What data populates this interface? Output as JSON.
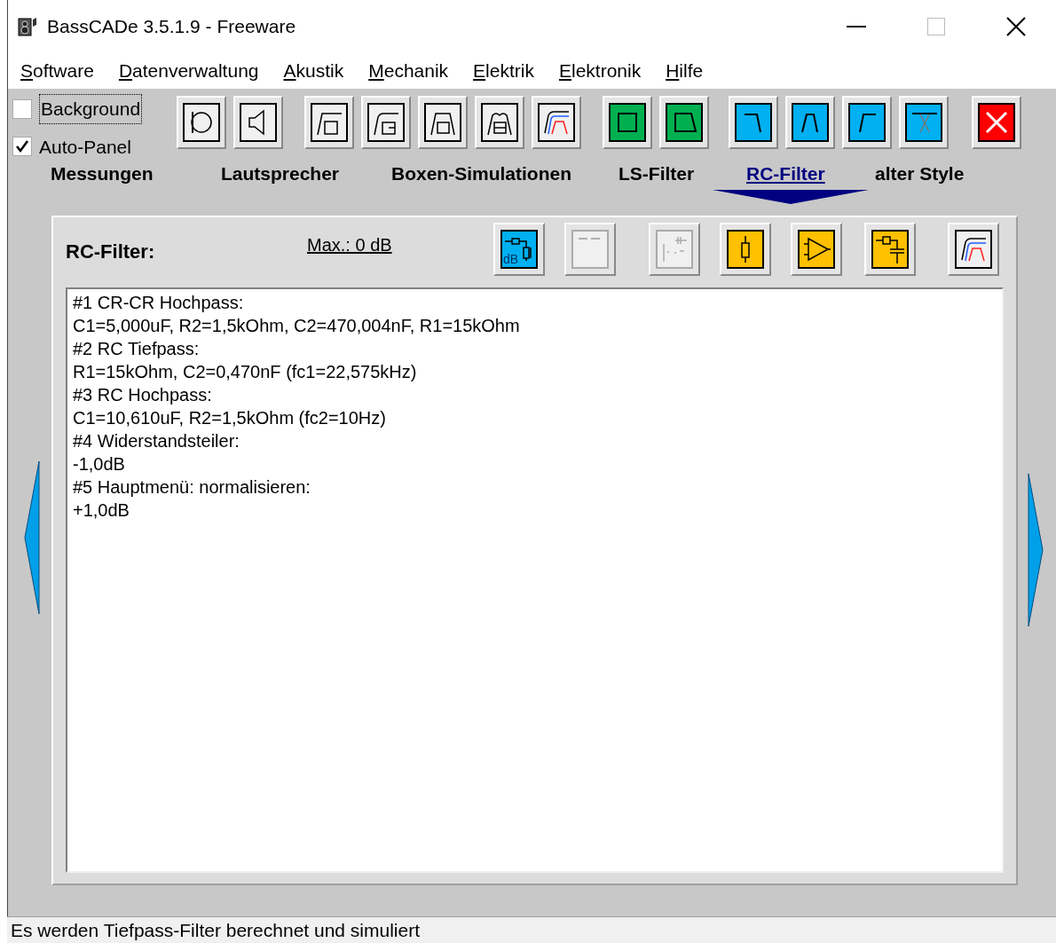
{
  "window": {
    "title": "BassCADe 3.5.1.9 - Freeware"
  },
  "menu": [
    {
      "key": "S",
      "rest": "oftware"
    },
    {
      "key": "D",
      "rest": "atenverwaltung"
    },
    {
      "key": "A",
      "rest": "kustik"
    },
    {
      "key": "M",
      "rest": "echanik"
    },
    {
      "key": "E",
      "rest": "lektrik"
    },
    {
      "key": "E",
      "rest": "lektronik"
    },
    {
      "key": "H",
      "rest": "ilfe"
    }
  ],
  "options": [
    {
      "label": "Background",
      "checked": false
    },
    {
      "label": "Auto-Panel",
      "checked": true
    }
  ],
  "toolbar": [
    {
      "label": "Messungen",
      "selected": false,
      "buttons": [
        {
          "kind": "round-speaker",
          "color": "#f0f0f0"
        },
        {
          "kind": "speaker",
          "color": "#f0f0f0"
        }
      ]
    },
    {
      "label": "Lautsprecher",
      "selected": false,
      "buttons": [
        {
          "kind": "closed-box",
          "color": "#f0f0f0"
        },
        {
          "kind": "vented-box",
          "color": "#f0f0f0"
        },
        {
          "kind": "bandpass-box",
          "color": "#f0f0f0"
        },
        {
          "kind": "double-box",
          "color": "#f0f0f0"
        },
        {
          "kind": "curves",
          "color": "#f0f0f0"
        }
      ]
    },
    {
      "label": "Boxen-Simulationen",
      "selected": false,
      "buttons": [
        {
          "kind": "square",
          "color": "#00b050"
        },
        {
          "kind": "trapezoid",
          "color": "#00b050"
        }
      ]
    },
    {
      "label": "LS-Filter",
      "selected": false,
      "buttons": [
        {
          "kind": "lowpass",
          "color": "#00b0f0"
        },
        {
          "kind": "bandpass",
          "color": "#00b0f0"
        },
        {
          "kind": "highpass",
          "color": "#00b0f0"
        },
        {
          "kind": "notch",
          "color": "#00b0f0"
        }
      ]
    },
    {
      "label": "RC-Filter",
      "selected": true,
      "buttons": [
        {
          "kind": "close",
          "color": "#ff0000"
        }
      ]
    },
    {
      "label": "alter Style",
      "selected": false
    }
  ],
  "panel": {
    "title": "RC-Filter:",
    "max_link": "Max.: 0 dB",
    "buttons": [
      {
        "kind": "attenuator",
        "color": "#00b0f0",
        "label": "dB",
        "disabled": false
      },
      {
        "kind": "blank",
        "color": "#f0f0f0",
        "disabled": true
      },
      {
        "kind": "circuit",
        "color": "#f0f0f0",
        "disabled": true
      },
      {
        "kind": "resistor",
        "color": "#ffc000",
        "disabled": false
      },
      {
        "kind": "amplifier",
        "color": "#ffc000",
        "disabled": false
      },
      {
        "kind": "rc",
        "color": "#ffc000",
        "disabled": false
      },
      {
        "kind": "curves",
        "color": "#f0f0f0",
        "disabled": false
      }
    ],
    "lines": [
      "#1 CR-CR Hochpass:",
      "C1=5,000uF, R2=1,5kOhm, C2=470,004nF, R1=15kOhm",
      "#2 RC Tiefpass:",
      "R1=15kOhm, C2=0,470nF (fc1=22,575kHz)",
      "#3 RC Hochpass:",
      "C1=10,610uF, R2=1,5kOhm (fc2=10Hz)",
      "#4 Widerstandsteiler:",
      "-1,0dB",
      "#5 Hauptmenü: normalisieren:",
      "+1,0dB"
    ]
  },
  "status_bar": "Es werden Tiefpass-Filter berechnet und simuliert"
}
